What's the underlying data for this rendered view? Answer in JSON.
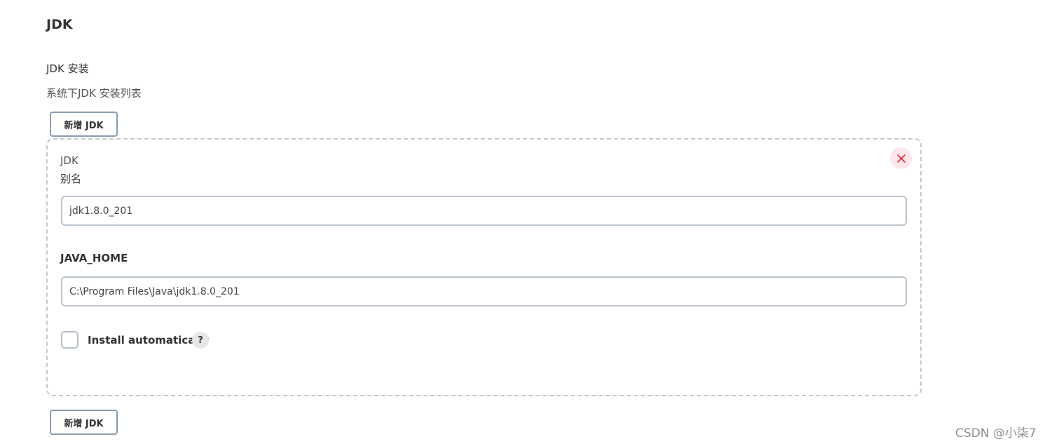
{
  "section": {
    "title": "JDK",
    "install_label": "JDK 安装",
    "description": "系统下JDK 安装列表"
  },
  "buttons": {
    "add_jdk_top": "新增 JDK",
    "add_jdk_bottom": "新增 JDK"
  },
  "jdk_entry": {
    "heading": "JDK",
    "alias_label": "别名",
    "alias_value": "jdk1.8.0_201",
    "java_home_label": "JAVA_HOME",
    "java_home_value": "C:\\Program Files\\Java\\jdk1.8.0_201",
    "install_automatically_label": "Install automatically",
    "install_automatically_checked": false,
    "help_symbol": "?",
    "delete_icon": "close-icon"
  },
  "colors": {
    "delete_icon": "#e0283a",
    "delete_bg": "#fde7ea",
    "button_border": "#8a9bb0",
    "card_border": "#c6c9ce"
  },
  "watermark": "CSDN @小柒7"
}
